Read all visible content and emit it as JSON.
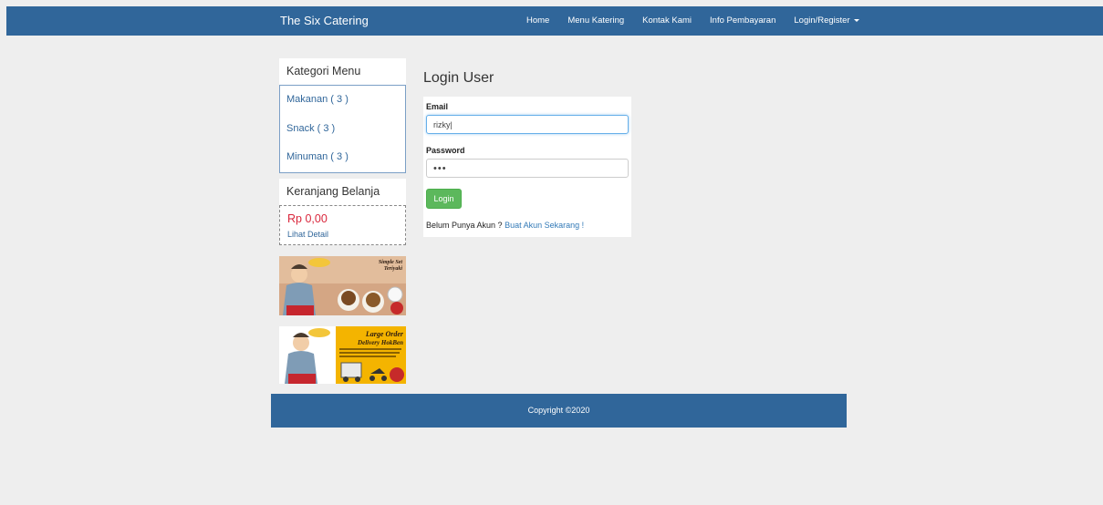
{
  "navbar": {
    "brand": "The Six Catering",
    "links": [
      "Home",
      "Menu Katering",
      "Kontak Kami",
      "Info Pembayaran"
    ],
    "dropdown_label": "Login/Register"
  },
  "sidebar": {
    "category_title": "Kategori Menu",
    "categories": [
      "Makanan ( 3 )",
      "Snack ( 3 )",
      "Minuman ( 3 )"
    ],
    "cart_title": "Keranjang Belanja",
    "cart_total": "Rp 0,00",
    "cart_detail_link": "Lihat Detail",
    "promos": [
      {
        "headline_1": "Simple Set",
        "headline_2": "Teriyaki"
      },
      {
        "headline_1": "Large Order",
        "headline_2": "Delivery HokBen"
      }
    ]
  },
  "login": {
    "title": "Login User",
    "email_label": "Email",
    "email_value": "rizky|",
    "password_label": "Password",
    "password_value": "•••",
    "button_label": "Login",
    "register_prompt": "Belum Punya Akun ?",
    "register_link": "Buat Akun Sekarang !"
  },
  "footer": {
    "copyright": "Copyright ©2020"
  },
  "colors": {
    "navbar": "#30669a",
    "background": "#eeeeee",
    "price": "#d9263b",
    "button": "#5cb85c",
    "link": "#337ab7"
  }
}
